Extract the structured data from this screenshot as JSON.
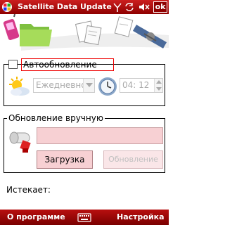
{
  "titlebar": {
    "title": "Satellite Data Update",
    "ok_label": "ok"
  },
  "auto_update": {
    "checkbox_label": "Автообновление",
    "checked": false,
    "frequency_value": "Ежедневно",
    "time_value": "04: 12"
  },
  "manual_update": {
    "group_label": "Обновление вручную",
    "field_value": "",
    "download_label": "Загрузка",
    "update_label": "Обновление"
  },
  "expires": {
    "label": "Истекает:"
  },
  "menubar": {
    "left_label": "О программе",
    "right_label": "Настройка"
  },
  "colors": {
    "titlebar_red": "#b00000",
    "field_pink": "#f7d0d3",
    "checkbox_border_red": "#e00000"
  },
  "icons": [
    "start-logo-icon",
    "connectivity-icon",
    "sync-icon",
    "volume-icon",
    "satellite-phone-icon",
    "folder-icon",
    "document-icon",
    "satellite-icon",
    "sun-cloud-icon",
    "clock-icon",
    "key-icon",
    "keyboard-icon"
  ]
}
